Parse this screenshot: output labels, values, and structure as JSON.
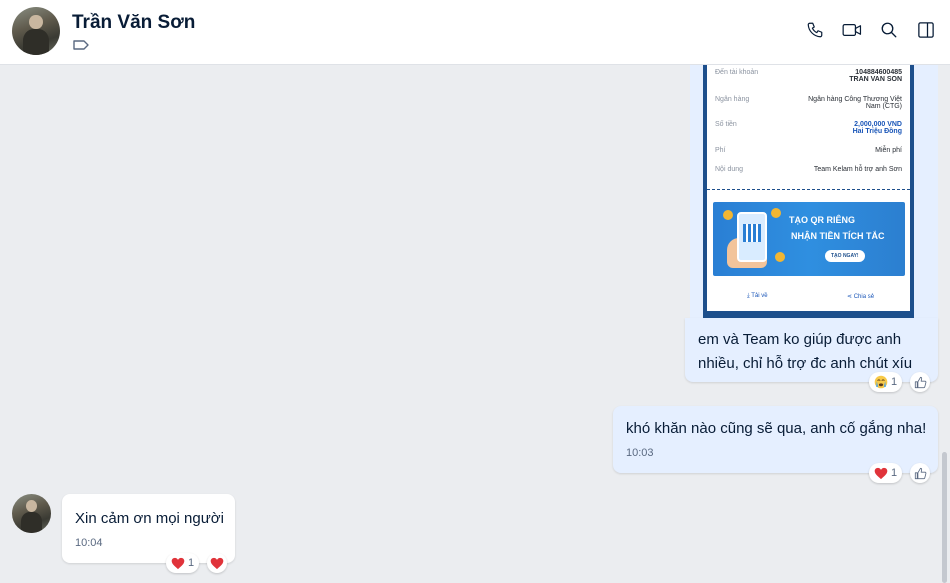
{
  "header": {
    "contact_name": "Trần Văn Sơn",
    "icons": [
      "tag-icon",
      "phone-icon",
      "video-call-icon",
      "search-icon",
      "sidebar-toggle-icon"
    ]
  },
  "receipt": {
    "rows": [
      {
        "label": "Đến tài khoản",
        "value_line1": "104884600485",
        "value_line2": "TRAN VAN SON"
      },
      {
        "label": "Ngân hàng",
        "value_line1": "Ngân hàng Công Thương Việt",
        "value_line2": "Nam (CTG)"
      },
      {
        "label": "Số tiền",
        "value_line1": "2,000,000 VND",
        "value_line2": "Hai Triệu Đồng"
      },
      {
        "label": "Phí",
        "value_line1": "Miễn phí"
      },
      {
        "label": "Nội dung",
        "value_line1": "Team Kelam hỗ trợ anh Sơn"
      }
    ],
    "banner": {
      "line1": "TẠO QR RIÊNG",
      "line2": "NHẬN TIỀN TÍCH TẮC",
      "button": "TẠO NGAY!"
    },
    "actions": {
      "download": "Tải về",
      "share": "Chia sẻ"
    }
  },
  "messages": [
    {
      "direction": "sent",
      "text": "em và Team ko giúp được anh nhiều, chỉ hỗ trợ đc anh chút xíu",
      "reaction_emoji": "crying-face-emoji",
      "reaction_count": "1"
    },
    {
      "direction": "sent",
      "text": "khó khăn nào cũng sẽ qua, anh cố gắng nha!",
      "time": "10:03",
      "reaction_emoji": "heart-emoji",
      "reaction_count": "1"
    },
    {
      "direction": "received",
      "text": "Xin cảm ơn mọi người",
      "time": "10:04",
      "reaction_emoji": "heart-emoji",
      "reaction_count": "1"
    }
  ],
  "colors": {
    "sent_bubble": "#e5efff",
    "received_bubble": "#ffffff",
    "chat_background": "#ebedf0",
    "heart": "#e0333a"
  }
}
